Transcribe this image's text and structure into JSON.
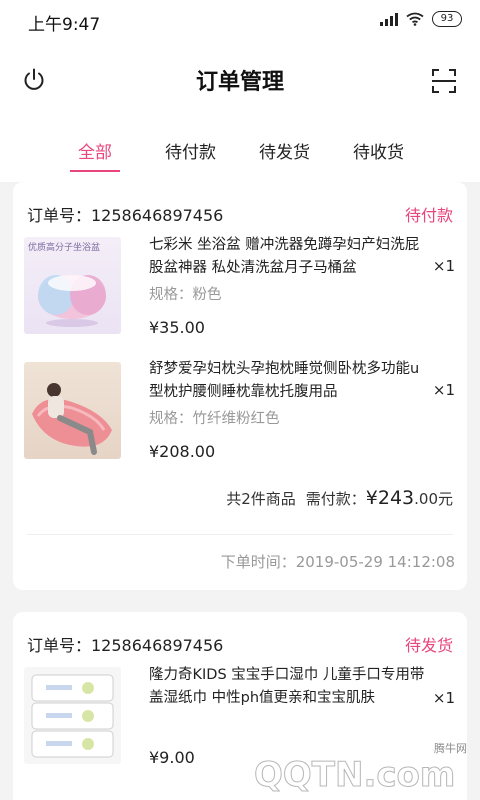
{
  "status_bar": {
    "time": "上午9:47",
    "battery": "93"
  },
  "header": {
    "title": "订单管理"
  },
  "tabs": [
    {
      "label": "全部",
      "active": true
    },
    {
      "label": "待付款",
      "active": false
    },
    {
      "label": "待发货",
      "active": false
    },
    {
      "label": "待收货",
      "active": false
    }
  ],
  "orders": [
    {
      "order_no": "订单号：1258646897456",
      "status": "待付款",
      "items": [
        {
          "name": "七彩米 坐浴盆 赠冲洗器免蹲孕妇产妇洗屁股盆神器 私处清洗盆月子马桶盆",
          "spec": "规格：粉色",
          "price": "¥35.00",
          "qty": "×1",
          "image_caption": "优质高分子坐浴盆"
        },
        {
          "name": "舒梦爱孕妇枕头孕抱枕睡觉侧卧枕多功能u型枕护腰侧睡枕靠枕托腹用品",
          "spec": "规格：竹纤维粉红色",
          "price": "¥208.00",
          "qty": "×1"
        }
      ],
      "summary_count": "共2件商品",
      "summary_label": "需付款：",
      "total_integer": "¥243",
      "total_decimal": ".00元",
      "time": "下单时间：2019-05-29 14:12:08"
    },
    {
      "order_no": "订单号：1258646897456",
      "status": "待发货",
      "items": [
        {
          "name": "隆力奇KIDS 宝宝手口湿巾 儿童手口专用带盖湿纸巾 中性ph值更亲和宝宝肌肤",
          "price": "¥9.00",
          "qty": "×1"
        }
      ]
    }
  ],
  "watermark": {
    "text": "QQTN.com",
    "sub": "腾牛网"
  },
  "colors": {
    "accent": "#e8467c",
    "muted": "#999999",
    "background": "#f3f3f3"
  }
}
